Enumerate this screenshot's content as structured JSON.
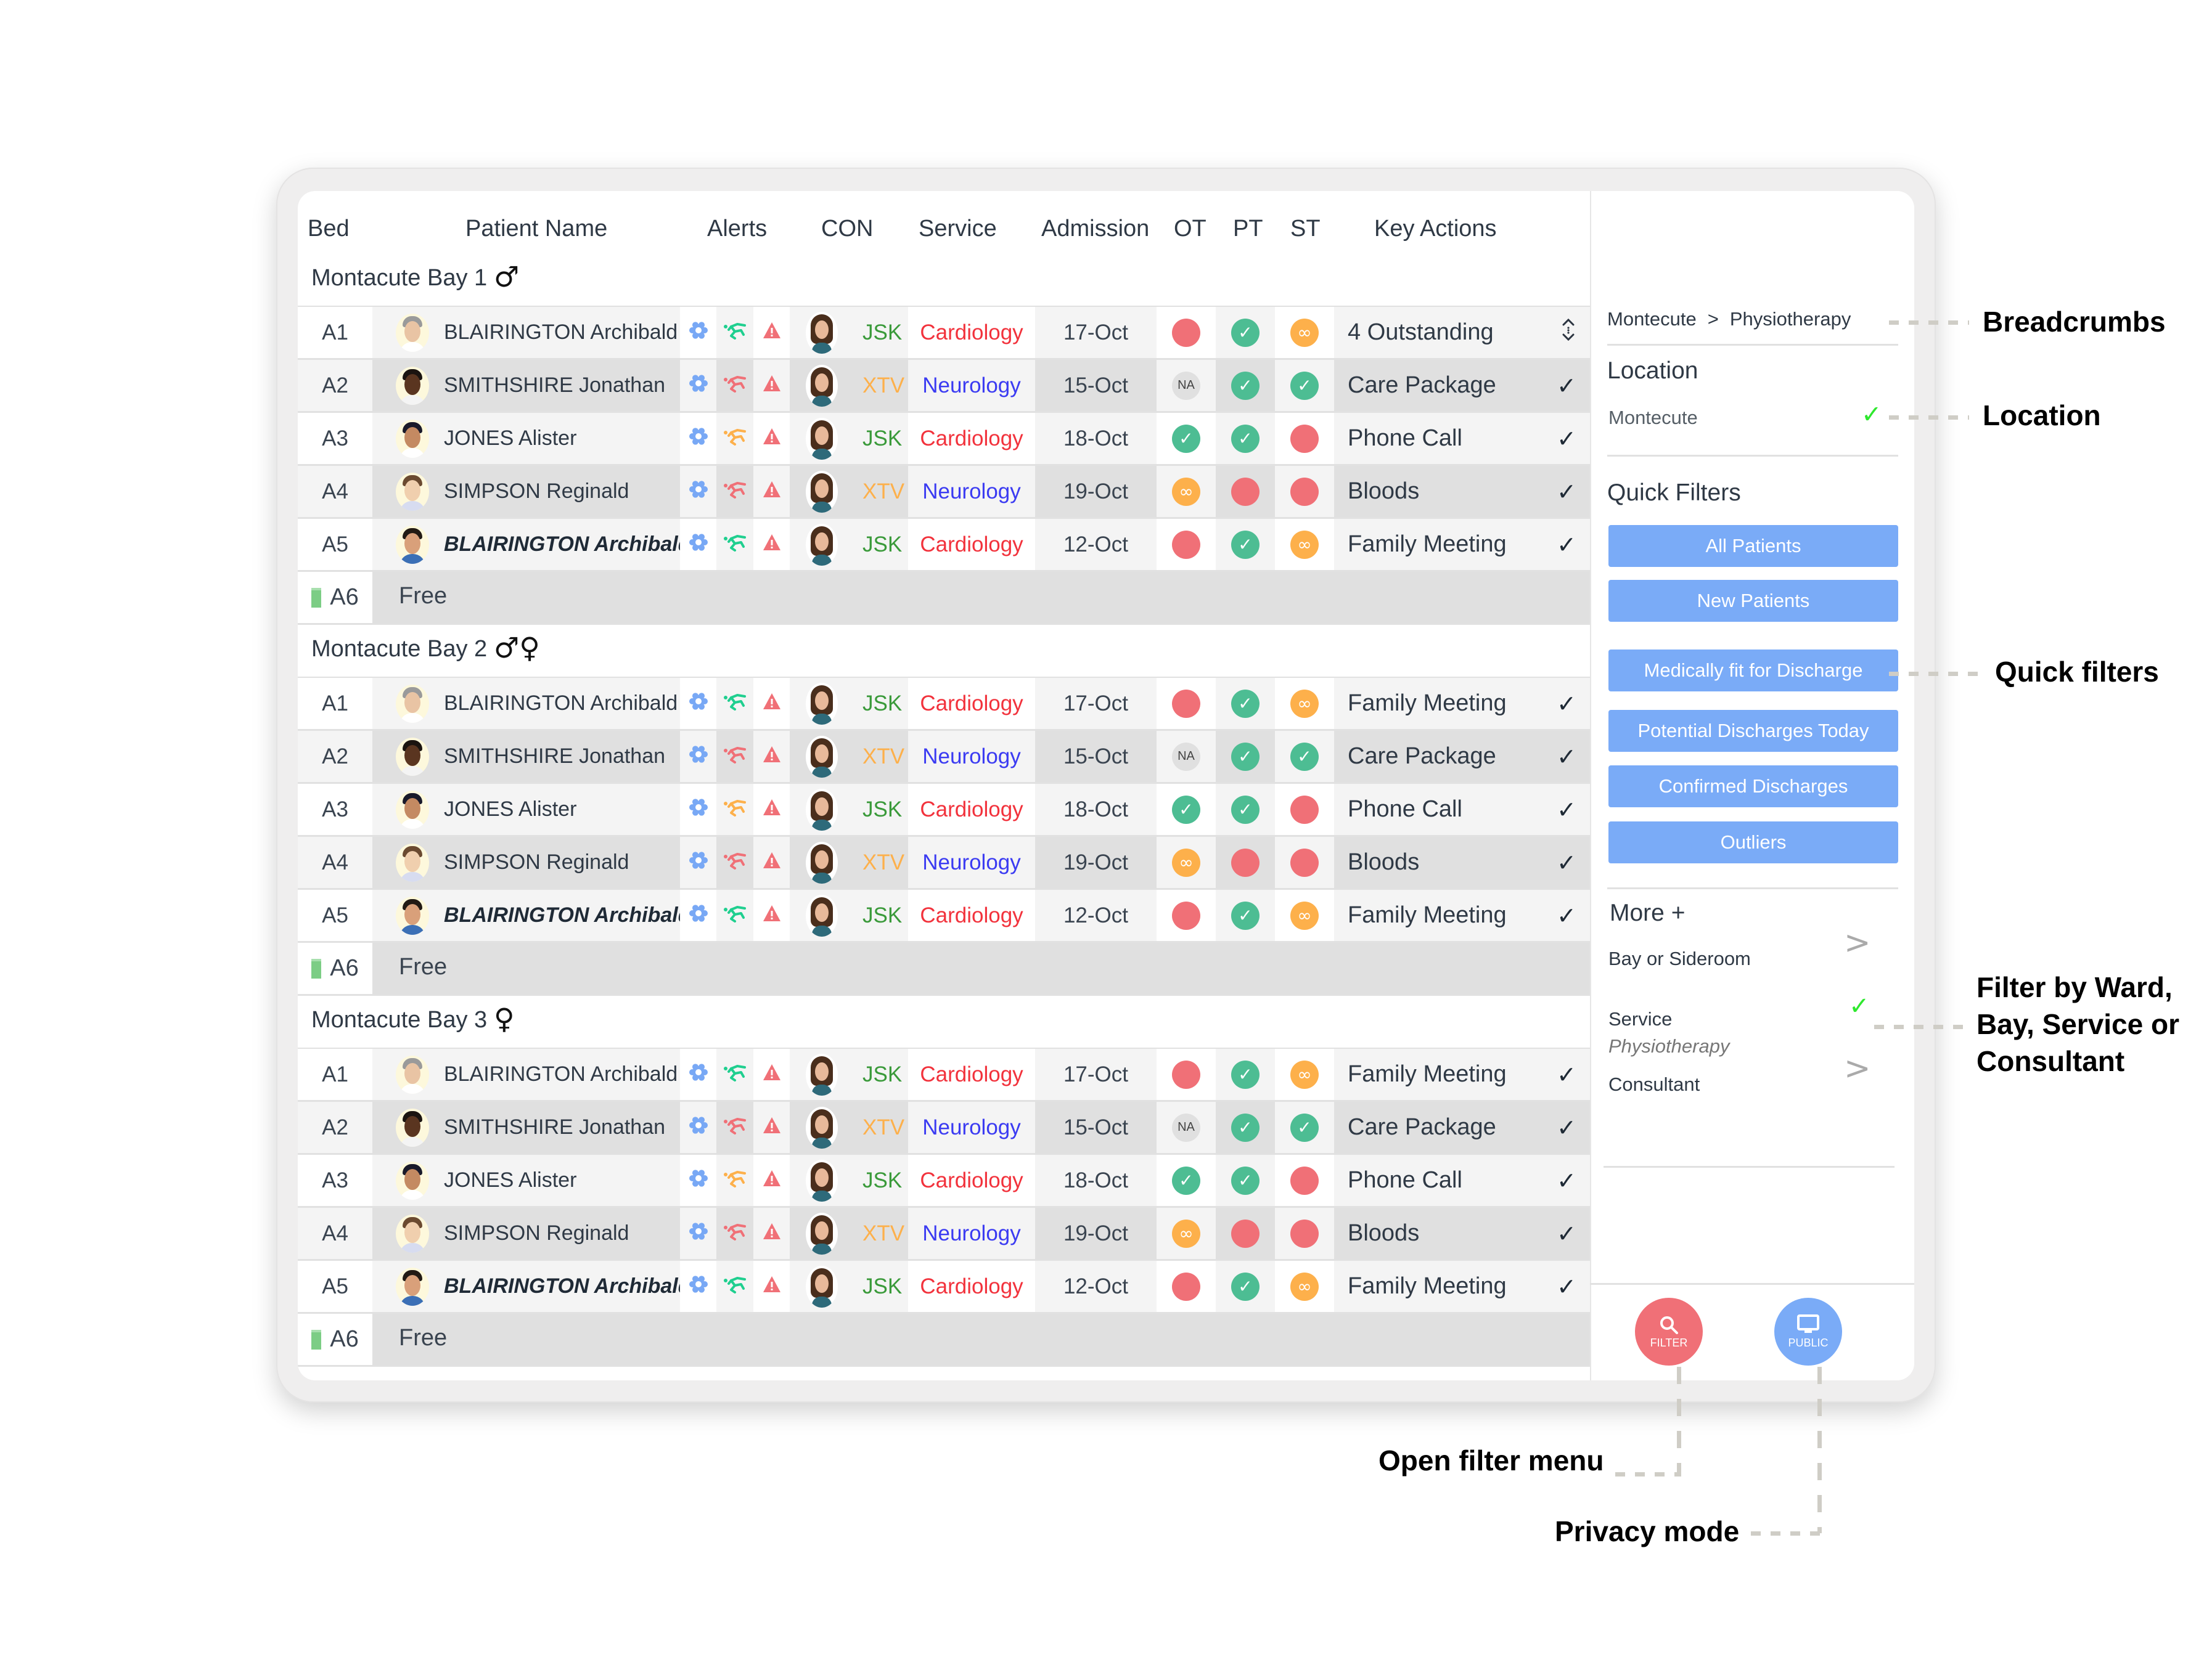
{
  "table": {
    "headers": {
      "bed": "Bed",
      "patient_name": "Patient Name",
      "alerts": "Alerts",
      "con": "CON",
      "service": "Service",
      "admission": "Admission",
      "ot": "OT",
      "pt": "PT",
      "st": "ST",
      "key_actions": "Key Actions"
    },
    "bays": [
      {
        "label": "Montacute Bay 1",
        "gender_icon": "male-icon",
        "gender_glyph": "♂",
        "rows": [
          {
            "bed": "A1",
            "name": "BLAIRINGTON Archibald",
            "emphasis": false,
            "fall_color": "#1fcf8f",
            "con": "JSK",
            "con_color": "#3a9a3a",
            "service": "Cardiology",
            "service_color": "#f2323c",
            "admission": "17-Oct",
            "ot": "red",
            "pt": "green",
            "st": "amber",
            "action": "4 Outstanding",
            "action_icon": "expand-icon"
          },
          {
            "bed": "A2",
            "name": "SMITHSHIRE Jonathan",
            "emphasis": false,
            "fall_color": "#f07077",
            "con": "XTV",
            "con_color": "#fdb04b",
            "service": "Neurology",
            "service_color": "#3b3bf2",
            "admission": "15-Oct",
            "ot": "na",
            "pt": "green",
            "st": "green",
            "action": "Care Package",
            "action_icon": "check-icon"
          },
          {
            "bed": "A3",
            "name": "JONES Alister",
            "emphasis": false,
            "fall_color": "#fdb04b",
            "con": "JSK",
            "con_color": "#3a9a3a",
            "service": "Cardiology",
            "service_color": "#f2323c",
            "admission": "18-Oct",
            "ot": "green",
            "pt": "green",
            "st": "red",
            "action": "Phone Call",
            "action_icon": "check-icon"
          },
          {
            "bed": "A4",
            "name": "SIMPSON Reginald",
            "emphasis": false,
            "fall_color": "#f07077",
            "con": "XTV",
            "con_color": "#fdb04b",
            "service": "Neurology",
            "service_color": "#3b3bf2",
            "admission": "19-Oct",
            "ot": "amber",
            "pt": "red",
            "st": "red",
            "action": "Bloods",
            "action_icon": "check-icon"
          },
          {
            "bed": "A5",
            "name": "BLAIRINGTON Archibald",
            "emphasis": true,
            "fall_color": "#1fcf8f",
            "con": "JSK",
            "con_color": "#3a9a3a",
            "service": "Cardiology",
            "service_color": "#f2323c",
            "admission": "12-Oct",
            "ot": "red",
            "pt": "green",
            "st": "amber",
            "action": "Family Meeting",
            "action_icon": "check-icon"
          }
        ],
        "free": {
          "bed": "A6",
          "label": "Free"
        }
      },
      {
        "label": "Montacute Bay 2",
        "gender_icon": "mixed-gender-icon",
        "gender_glyph": "♂♀",
        "rows": [
          {
            "bed": "A1",
            "name": "BLAIRINGTON Archibald",
            "emphasis": false,
            "fall_color": "#1fcf8f",
            "con": "JSK",
            "con_color": "#3a9a3a",
            "service": "Cardiology",
            "service_color": "#f2323c",
            "admission": "17-Oct",
            "ot": "red",
            "pt": "green",
            "st": "amber",
            "action": "Family Meeting",
            "action_icon": "check-icon"
          },
          {
            "bed": "A2",
            "name": "SMITHSHIRE Jonathan",
            "emphasis": false,
            "fall_color": "#f07077",
            "con": "XTV",
            "con_color": "#fdb04b",
            "service": "Neurology",
            "service_color": "#3b3bf2",
            "admission": "15-Oct",
            "ot": "na",
            "pt": "green",
            "st": "green",
            "action": "Care Package",
            "action_icon": "check-icon"
          },
          {
            "bed": "A3",
            "name": "JONES Alister",
            "emphasis": false,
            "fall_color": "#fdb04b",
            "con": "JSK",
            "con_color": "#3a9a3a",
            "service": "Cardiology",
            "service_color": "#f2323c",
            "admission": "18-Oct",
            "ot": "green",
            "pt": "green",
            "st": "red",
            "action": "Phone Call",
            "action_icon": "check-icon"
          },
          {
            "bed": "A4",
            "name": "SIMPSON Reginald",
            "emphasis": false,
            "fall_color": "#f07077",
            "con": "XTV",
            "con_color": "#fdb04b",
            "service": "Neurology",
            "service_color": "#3b3bf2",
            "admission": "19-Oct",
            "ot": "amber",
            "pt": "red",
            "st": "red",
            "action": "Bloods",
            "action_icon": "check-icon"
          },
          {
            "bed": "A5",
            "name": "BLAIRINGTON Archibald",
            "emphasis": true,
            "fall_color": "#1fcf8f",
            "con": "JSK",
            "con_color": "#3a9a3a",
            "service": "Cardiology",
            "service_color": "#f2323c",
            "admission": "12-Oct",
            "ot": "red",
            "pt": "green",
            "st": "amber",
            "action": "Family Meeting",
            "action_icon": "check-icon"
          }
        ],
        "free": {
          "bed": "A6",
          "label": "Free"
        }
      },
      {
        "label": "Montacute Bay 3",
        "gender_icon": "female-icon",
        "gender_glyph": "♀",
        "rows": [
          {
            "bed": "A1",
            "name": "BLAIRINGTON Archibald",
            "emphasis": false,
            "fall_color": "#1fcf8f",
            "con": "JSK",
            "con_color": "#3a9a3a",
            "service": "Cardiology",
            "service_color": "#f2323c",
            "admission": "17-Oct",
            "ot": "red",
            "pt": "green",
            "st": "amber",
            "action": "Family Meeting",
            "action_icon": "check-icon"
          },
          {
            "bed": "A2",
            "name": "SMITHSHIRE Jonathan",
            "emphasis": false,
            "fall_color": "#f07077",
            "con": "XTV",
            "con_color": "#fdb04b",
            "service": "Neurology",
            "service_color": "#3b3bf2",
            "admission": "15-Oct",
            "ot": "na",
            "pt": "green",
            "st": "green",
            "action": "Care Package",
            "action_icon": "check-icon"
          },
          {
            "bed": "A3",
            "name": "JONES Alister",
            "emphasis": false,
            "fall_color": "#fdb04b",
            "con": "JSK",
            "con_color": "#3a9a3a",
            "service": "Cardiology",
            "service_color": "#f2323c",
            "admission": "18-Oct",
            "ot": "green",
            "pt": "green",
            "st": "red",
            "action": "Phone Call",
            "action_icon": "check-icon"
          },
          {
            "bed": "A4",
            "name": "SIMPSON Reginald",
            "emphasis": false,
            "fall_color": "#f07077",
            "con": "XTV",
            "con_color": "#fdb04b",
            "service": "Neurology",
            "service_color": "#3b3bf2",
            "admission": "19-Oct",
            "ot": "amber",
            "pt": "red",
            "st": "red",
            "action": "Bloods",
            "action_icon": "check-icon"
          },
          {
            "bed": "A5",
            "name": "BLAIRINGTON Archibald",
            "emphasis": true,
            "fall_color": "#1fcf8f",
            "con": "JSK",
            "con_color": "#3a9a3a",
            "service": "Cardiology",
            "service_color": "#f2323c",
            "admission": "12-Oct",
            "ot": "red",
            "pt": "green",
            "st": "amber",
            "action": "Family Meeting",
            "action_icon": "check-icon"
          }
        ],
        "free": {
          "bed": "A6",
          "label": "Free"
        }
      }
    ],
    "status_na_label": "NA",
    "colors": {
      "red": "#f07077",
      "green": "#4dbd93",
      "amber": "#fdb04b",
      "na": "#e0e0e0",
      "gear": "#78a8f5",
      "warning": "#f07077"
    }
  },
  "sidebar": {
    "breadcrumb": [
      "Montecute",
      "Physiotherapy"
    ],
    "breadcrumb_separator": ">",
    "location_title": "Location",
    "location_value": "Montecute",
    "quick_filters_title": "Quick Filters",
    "quick_filters": [
      "All Patients",
      "New Patients",
      "Medically fit for Discharge",
      "Potential Discharges Today",
      "Confirmed Discharges",
      "Outliers"
    ],
    "more_title": "More +",
    "more_items": {
      "bay": "Bay or Sideroom",
      "service": "Service",
      "service_value": "Physiotherapy",
      "consultant": "Consultant"
    },
    "accent_color": "#7aabf7"
  },
  "fabs": {
    "filter_label": "FILTER",
    "public_label": "PUBLIC"
  },
  "annotations": {
    "breadcrumbs": "Breadcrumbs",
    "location": "Location",
    "quick_filters": "Quick filters",
    "filter_by": [
      "Filter by Ward,",
      "Bay, Service or",
      "Consultant"
    ],
    "open_filter": "Open filter menu",
    "privacy": "Privacy mode"
  }
}
